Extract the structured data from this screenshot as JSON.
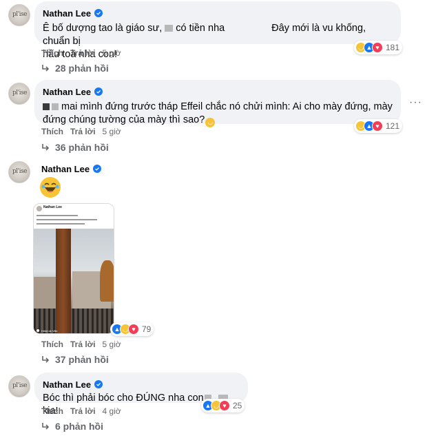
{
  "comments": [
    {
      "author": "Nathan Lee",
      "text_a": "Ê bố dượng tao là giáo sư, ",
      "text_b": " có tiền nha ",
      "text_c": "Đây mới là vu khống, chuẩn bị",
      "text_line2": "hầu toà nha con!",
      "like_label": "Thích",
      "reply_label": "Trả lời",
      "time": "5 giờ",
      "reaction_count": "181",
      "replies": "28 phản hồi"
    },
    {
      "author": "Nathan Lee",
      "text_line1": "mai mình đứng trước tháp Effeil chắc nó chửi mình: Ai cho mày đứng, mày",
      "text_line2": "đứng chúng tường của mày thì sao?",
      "like_label": "Thích",
      "reply_label": "Trả lời",
      "time": "5 giờ",
      "reaction_count": "121",
      "replies": "36 phản hồi"
    },
    {
      "author": "Nathan Lee",
      "like_label": "Thích",
      "reply_label": "Trả lời",
      "time": "5 giờ",
      "reaction_count": "79",
      "replies": "37 phản hồi",
      "screenshot": {
        "author": "Nathan Lee",
        "caption": "Hôtel de Ville"
      }
    },
    {
      "author": "Nathan Lee",
      "text_a": "Bóc thì phải bóc cho ĐÚNG nha con",
      "text_b": "kia!",
      "like_label": "Thích",
      "reply_label": "Trả lời",
      "time": "4 giờ",
      "reaction_count": "25",
      "replies": "6 phản hồi"
    }
  ],
  "more_menu": "···",
  "colors": {
    "bubble": "#f0f2f5",
    "verified": "#1877f2",
    "meta_text": "#65676b",
    "haha": "#f7c437",
    "like": "#1877f2",
    "love": "#f33e58"
  },
  "icons": [
    "verified-badge-icon",
    "reply-arrow-icon",
    "haha-reaction-icon",
    "like-reaction-icon",
    "love-reaction-icon",
    "more-options-icon",
    "laughing-emoji-icon",
    "location-pin-icon"
  ]
}
